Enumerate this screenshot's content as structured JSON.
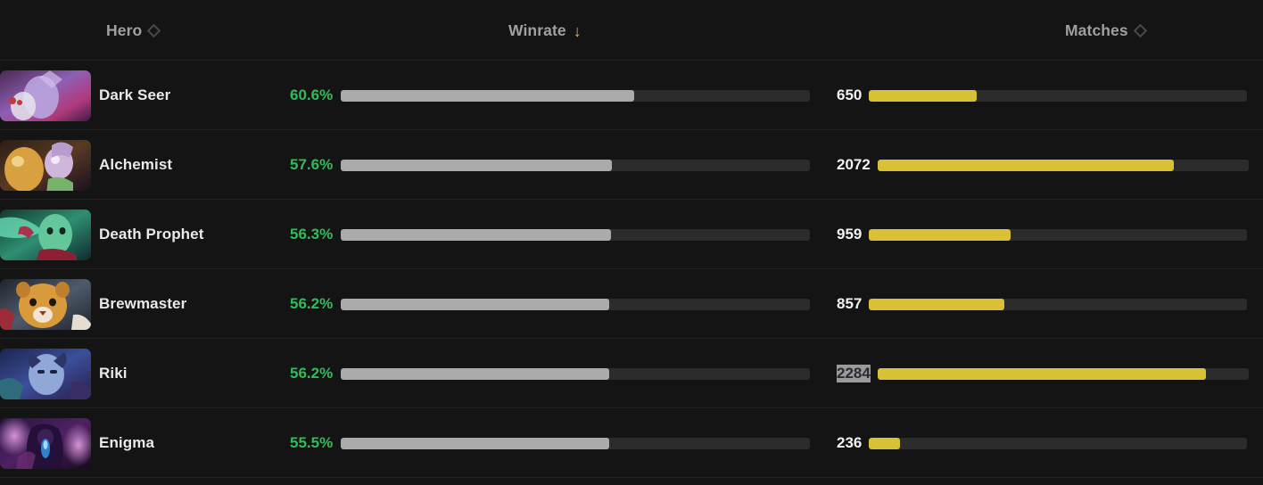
{
  "table": {
    "columns": [
      {
        "key": "hero",
        "label": "Hero",
        "sort_icon": "sort-diamond-icon",
        "sorted": false
      },
      {
        "key": "winrate",
        "label": "Winrate",
        "sort_icon": "sort-arrow-down-icon",
        "sorted": true,
        "direction": "desc",
        "sort_glyph": "↓"
      },
      {
        "key": "matches",
        "label": "Matches",
        "sort_icon": "sort-diamond-icon",
        "sorted": false
      }
    ],
    "colors": {
      "background": "#141414",
      "row_divider": "#202020",
      "header_text": "#a0a0a0",
      "hero_name_text": "#e9e9e9",
      "winrate_text": "#2ebd59",
      "winrate_bar_fill": "#ababab",
      "matches_text": "#f2f2f2",
      "matches_bar_fill": "#d8c134",
      "bar_track": "#2c2c2c",
      "sort_active": "#e0bb3c",
      "selection_highlight": "#9b9b9b"
    },
    "rows": [
      {
        "hero": "Dark Seer",
        "portrait": "dark-seer-portrait",
        "winrate": "60.6%",
        "winrate_pct": 60.6,
        "winrate_bar_fraction": 0.625,
        "matches": "650",
        "matches_count": 650,
        "matches_bar_fraction": 0.285,
        "matches_selected": false
      },
      {
        "hero": "Alchemist",
        "portrait": "alchemist-portrait",
        "winrate": "57.6%",
        "winrate_pct": 57.6,
        "winrate_bar_fraction": 0.578,
        "matches": "2072",
        "matches_count": 2072,
        "matches_bar_fraction": 0.799,
        "matches_selected": false
      },
      {
        "hero": "Death Prophet",
        "portrait": "death-prophet-portrait",
        "winrate": "56.3%",
        "winrate_pct": 56.3,
        "winrate_bar_fraction": 0.576,
        "matches": "959",
        "matches_count": 959,
        "matches_bar_fraction": 0.374,
        "matches_selected": false
      },
      {
        "hero": "Brewmaster",
        "portrait": "brewmaster-portrait",
        "winrate": "56.2%",
        "winrate_pct": 56.2,
        "winrate_bar_fraction": 0.573,
        "matches": "857",
        "matches_count": 857,
        "matches_bar_fraction": 0.358,
        "matches_selected": false
      },
      {
        "hero": "Riki",
        "portrait": "riki-portrait",
        "winrate": "56.2%",
        "winrate_pct": 56.2,
        "winrate_bar_fraction": 0.573,
        "matches": "2284",
        "matches_count": 2284,
        "matches_bar_fraction": 0.885,
        "matches_selected": true
      },
      {
        "hero": "Enigma",
        "portrait": "enigma-portrait",
        "winrate": "55.5%",
        "winrate_pct": 55.5,
        "winrate_bar_fraction": 0.573,
        "matches": "236",
        "matches_count": 236,
        "matches_bar_fraction": 0.082,
        "matches_selected": false
      }
    ]
  }
}
